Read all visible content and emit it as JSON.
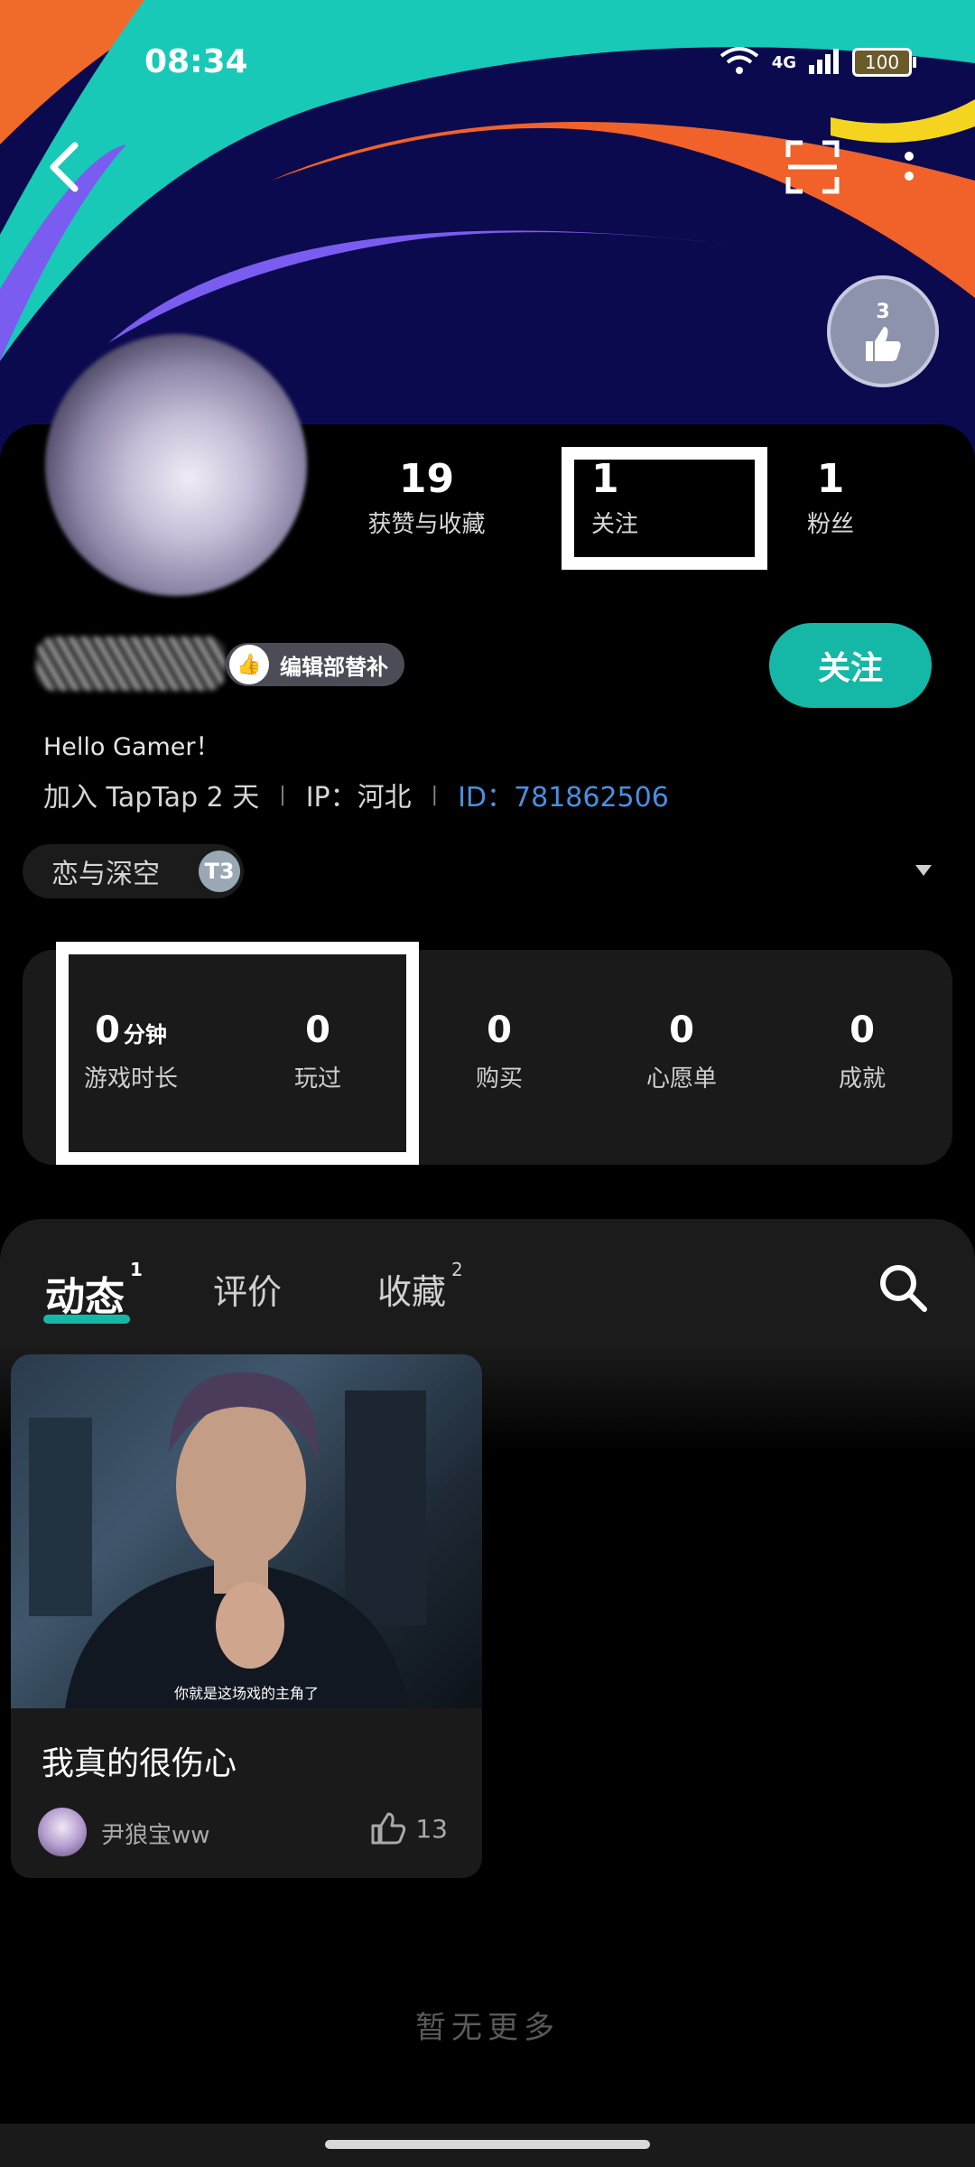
{
  "status_bar": {
    "time": "08:34",
    "network": "4G",
    "battery": "100"
  },
  "profile": {
    "stats": [
      {
        "value": "19",
        "label": "获赞与收藏"
      },
      {
        "value": "1",
        "label": "关注"
      },
      {
        "value": "1",
        "label": "粉丝"
      }
    ],
    "editor_tag": "编辑部替补",
    "badge_level": "3",
    "follow_label": "关注",
    "bio": "Hello Gamer！",
    "joined": "加入 TapTap 2 天",
    "ip": "IP：河北",
    "id": "ID：781862506",
    "game_chip": {
      "name": "恋与深空",
      "level": "T3"
    }
  },
  "game_stats": [
    {
      "value": "0",
      "unit": "分钟",
      "label": "游戏时长"
    },
    {
      "value": "0",
      "unit": "",
      "label": "玩过"
    },
    {
      "value": "0",
      "unit": "",
      "label": "购买"
    },
    {
      "value": "0",
      "unit": "",
      "label": "心愿单"
    },
    {
      "value": "0",
      "unit": "",
      "label": "成就"
    }
  ],
  "tabs": [
    {
      "label": "动态",
      "count": "1"
    },
    {
      "label": "评价",
      "count": ""
    },
    {
      "label": "收藏",
      "count": "2"
    }
  ],
  "posts": [
    {
      "title": "我真的很伤心",
      "author": "尹狼宝ww",
      "likes": "13",
      "caption": "你就是这场戏的主角了"
    }
  ],
  "empty_text": "暂无更多",
  "colors": {
    "accent": "#15b8a6",
    "id_link": "#4a8fe0"
  }
}
